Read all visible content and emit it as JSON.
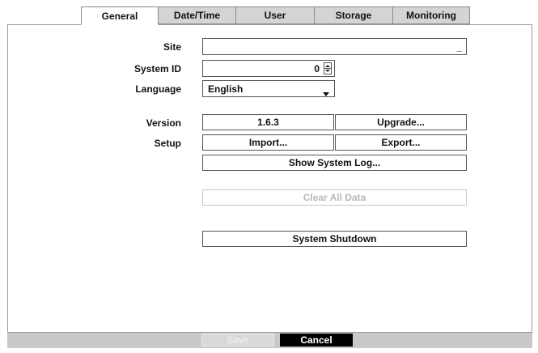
{
  "tabs": [
    {
      "label": "General",
      "active": true
    },
    {
      "label": "Date/Time",
      "active": false
    },
    {
      "label": "User",
      "active": false
    },
    {
      "label": "Storage",
      "active": false
    },
    {
      "label": "Monitoring",
      "active": false
    }
  ],
  "form": {
    "site_label": "Site",
    "site_value": "",
    "site_cursor": "_",
    "system_id_label": "System ID",
    "system_id_value": "0",
    "language_label": "Language",
    "language_value": "English",
    "version_label": "Version",
    "version_value": "1.6.3",
    "upgrade_label": "Upgrade...",
    "setup_label": "Setup",
    "import_label": "Import...",
    "export_label": "Export...",
    "show_log_label": "Show System Log...",
    "clear_data_label": "Clear All Data",
    "shutdown_label": "System Shutdown"
  },
  "footer": {
    "save_label": "Save",
    "cancel_label": "Cancel"
  }
}
